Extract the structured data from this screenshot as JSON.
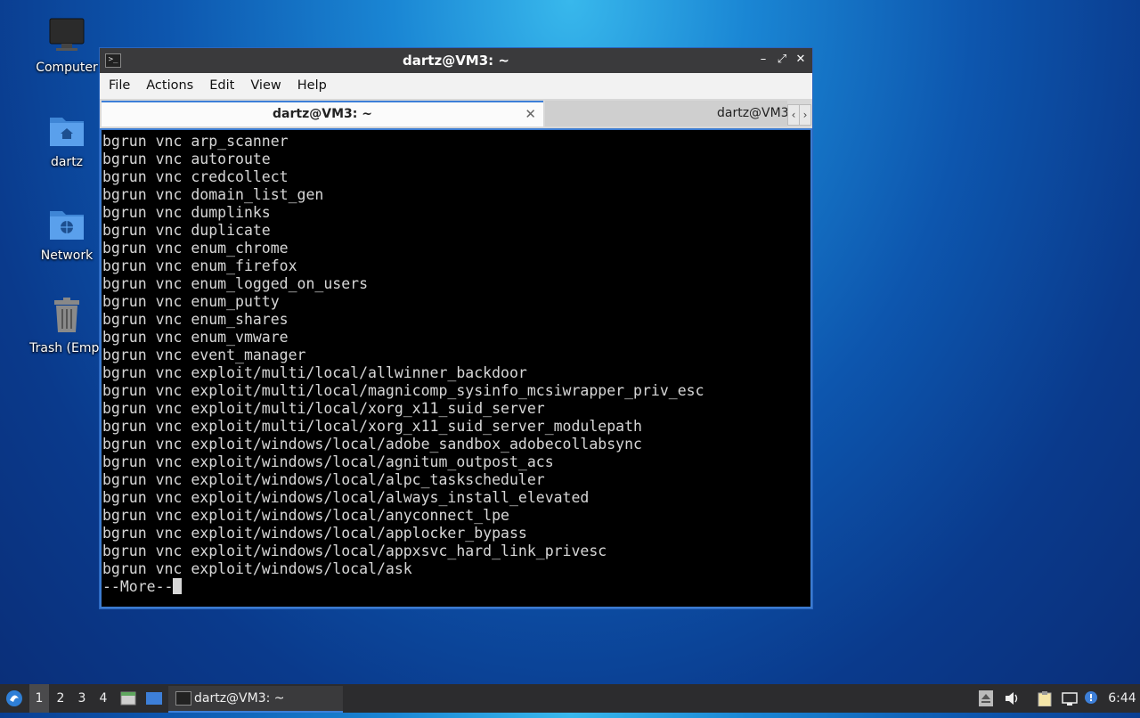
{
  "desktop": {
    "icons": [
      {
        "label": "Computer",
        "icon": "monitor-icon"
      },
      {
        "label": "dartz",
        "icon": "home-folder-icon"
      },
      {
        "label": "Network",
        "icon": "network-folder-icon"
      },
      {
        "label": "Trash (Empt",
        "icon": "trash-icon"
      }
    ]
  },
  "window": {
    "title": "dartz@VM3: ~",
    "menu": [
      "File",
      "Actions",
      "Edit",
      "View",
      "Help"
    ],
    "tabs": [
      {
        "label": "dartz@VM3: ~",
        "active": true
      },
      {
        "label": "dartz@VM3",
        "active": false
      }
    ],
    "terminal_lines": [
      "bgrun vnc arp_scanner",
      "bgrun vnc autoroute",
      "bgrun vnc credcollect",
      "bgrun vnc domain_list_gen",
      "bgrun vnc dumplinks",
      "bgrun vnc duplicate",
      "bgrun vnc enum_chrome",
      "bgrun vnc enum_firefox",
      "bgrun vnc enum_logged_on_users",
      "bgrun vnc enum_putty",
      "bgrun vnc enum_shares",
      "bgrun vnc enum_vmware",
      "bgrun vnc event_manager",
      "bgrun vnc exploit/multi/local/allwinner_backdoor",
      "bgrun vnc exploit/multi/local/magnicomp_sysinfo_mcsiwrapper_priv_esc",
      "bgrun vnc exploit/multi/local/xorg_x11_suid_server",
      "bgrun vnc exploit/multi/local/xorg_x11_suid_server_modulepath",
      "bgrun vnc exploit/windows/local/adobe_sandbox_adobecollabsync",
      "bgrun vnc exploit/windows/local/agnitum_outpost_acs",
      "bgrun vnc exploit/windows/local/alpc_taskscheduler",
      "bgrun vnc exploit/windows/local/always_install_elevated",
      "bgrun vnc exploit/windows/local/anyconnect_lpe",
      "bgrun vnc exploit/windows/local/applocker_bypass",
      "bgrun vnc exploit/windows/local/appxsvc_hard_link_privesc",
      "bgrun vnc exploit/windows/local/ask"
    ],
    "pager_prompt": "--More--"
  },
  "taskbar": {
    "workspaces": [
      "1",
      "2",
      "3",
      "4"
    ],
    "active_workspace": "1",
    "task_label": "dartz@VM3: ~",
    "clock": "6:44"
  }
}
